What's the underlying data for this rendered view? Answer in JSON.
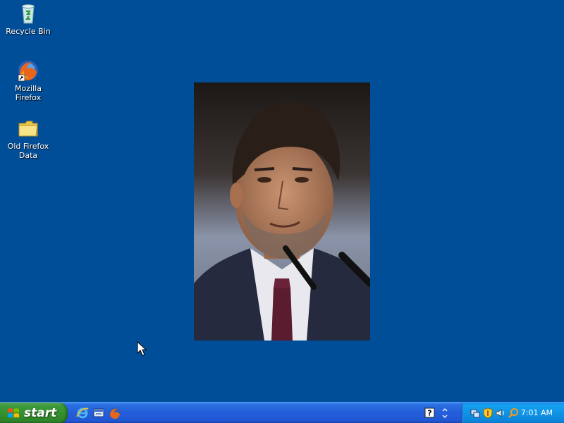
{
  "desktop": {
    "background": "#004e98",
    "icons": [
      {
        "label": "Recycle Bin",
        "icon": "recycle-bin-icon"
      },
      {
        "label": "Mozilla Firefox",
        "icon": "firefox-icon"
      },
      {
        "label": "Old Firefox\nData",
        "icon": "folder-icon"
      }
    ]
  },
  "photo": {
    "icon": "person-portrait-photo"
  },
  "taskbar": {
    "start_label": "start",
    "quick_launch": [
      {
        "icon": "internet-explorer-icon"
      },
      {
        "icon": "show-desktop-icon"
      },
      {
        "icon": "firefox-icon"
      }
    ],
    "tray": {
      "time": "7:01 AM",
      "icons": [
        "network-icon",
        "security-shield-icon",
        "sound-icon",
        "search-icon"
      ]
    }
  }
}
